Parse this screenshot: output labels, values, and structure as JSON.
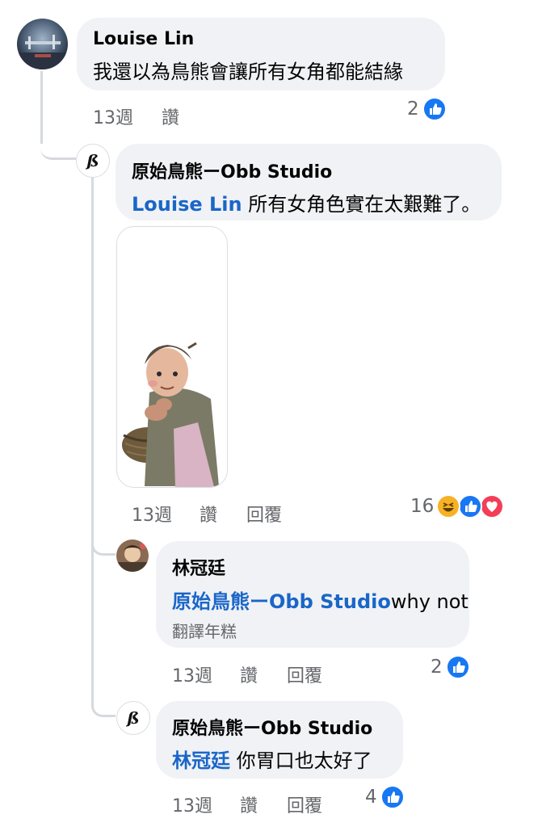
{
  "comments": [
    {
      "author": "Louise Lin",
      "text": "我還以為鳥熊會讓所有女角都能結緣",
      "time": "13週",
      "like": "讚",
      "reaction_count": "2",
      "reactions": [
        "like"
      ]
    },
    {
      "author": "原始鳥熊ーObb Studio",
      "mention": "Louise Lin",
      "text": " 所有女角色實在太艱難了。",
      "attachment": "sticker-old-woman-with-basket",
      "time": "13週",
      "like": "讚",
      "reply": "回覆",
      "reaction_count": "16",
      "reactions": [
        "haha",
        "like",
        "love"
      ]
    },
    {
      "author": "林冠廷",
      "mention": "原始鳥熊ーObb Studio",
      "text": "why not",
      "translate": "翻譯年糕",
      "time": "13週",
      "like": "讚",
      "reply": "回覆",
      "reaction_count": "2",
      "reactions": [
        "like"
      ]
    },
    {
      "author": "原始鳥熊ーObb Studio",
      "mention": "林冠廷",
      "text": " 你胃口也太好了",
      "time": "13週",
      "like": "讚",
      "reply": "回覆",
      "reaction_count": "4",
      "reactions": [
        "like"
      ]
    }
  ],
  "colors": {
    "bubble": "#f0f2f5",
    "mention": "#1a66c8",
    "meta": "#65676b",
    "like": "#1877f2",
    "haha": "#f7b125",
    "love": "#f33e58"
  }
}
